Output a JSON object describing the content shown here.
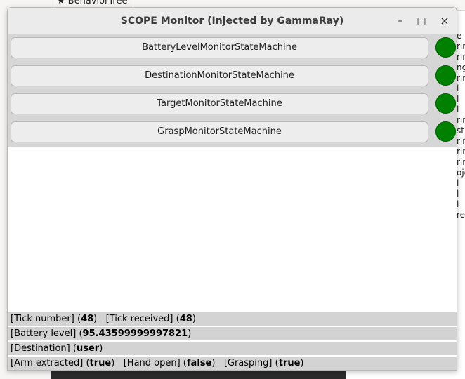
{
  "background": {
    "tab_label": "BehaviorTree",
    "right_fragments": [
      "e",
      "rin",
      "rin",
      "ng",
      "rin",
      "l",
      "l",
      "l",
      "rin",
      "st",
      "rin",
      "rin",
      "rin",
      "oje",
      "l",
      "l",
      "l",
      "re"
    ]
  },
  "window": {
    "title": "SCOPE Monitor (Injected by GammaRay)",
    "controls": {
      "minimize": "–",
      "maximize": "□",
      "close": "×"
    }
  },
  "state_machines": [
    {
      "label": "BatteryLevelMonitorStateMachine",
      "status_color": "#008000"
    },
    {
      "label": "DestinationMonitorStateMachine",
      "status_color": "#008000"
    },
    {
      "label": "TargetMonitorStateMachine",
      "status_color": "#008000"
    },
    {
      "label": "GraspMonitorStateMachine",
      "status_color": "#008000"
    }
  ],
  "status": {
    "tick_number_label": "[Tick number]",
    "tick_number_value": "48",
    "tick_received_label": "[Tick received]",
    "tick_received_value": "48",
    "battery_label": "[Battery level]",
    "battery_value": "95.43599999997821",
    "destination_label": "[Destination]",
    "destination_value": "user",
    "arm_label": "[Arm extracted]",
    "arm_value": "true",
    "hand_label": "[Hand open]",
    "hand_value": "false",
    "grasping_label": "[Grasping]",
    "grasping_value": "true"
  }
}
